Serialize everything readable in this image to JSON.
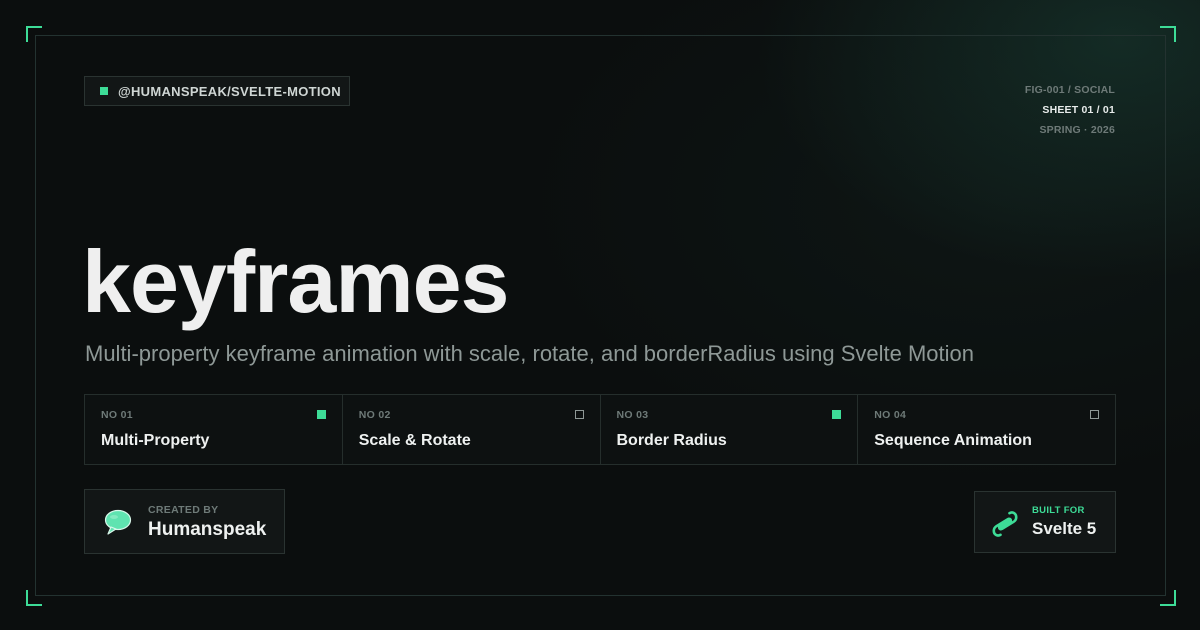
{
  "package": {
    "label": "@HUMANSPEAK/SVELTE-MOTION"
  },
  "meta": {
    "fig": "FIG-001 / SOCIAL",
    "sheet": "SHEET 01 / 01",
    "season": "SPRING · 2026"
  },
  "title": "keyframes",
  "subtitle": "Multi-property keyframe animation with scale, rotate, and borderRadius using Svelte Motion",
  "features": [
    {
      "no": "NO 01",
      "name": "Multi-Property",
      "marker": "filled"
    },
    {
      "no": "NO 02",
      "name": "Scale & Rotate",
      "marker": "outline"
    },
    {
      "no": "NO 03",
      "name": "Border Radius",
      "marker": "filled"
    },
    {
      "no": "NO 04",
      "name": "Sequence Animation",
      "marker": "outline"
    }
  ],
  "creator": {
    "label": "CREATED BY",
    "name": "Humanspeak",
    "icon": "speech-bubble-icon"
  },
  "built_for": {
    "label": "BUILT FOR",
    "name": "Svelte 5",
    "icon": "svelte-logo-icon"
  },
  "colors": {
    "accent": "#3ddc97",
    "background": "#0b0e0e",
    "muted": "#6e7a78"
  }
}
